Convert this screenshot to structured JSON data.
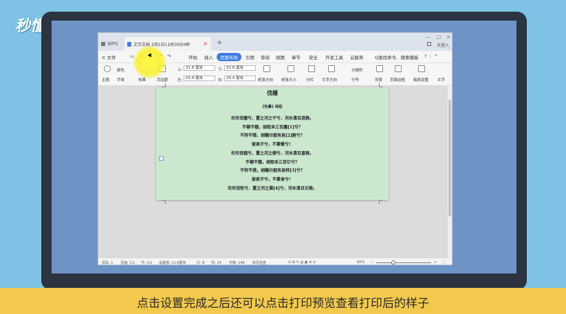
{
  "watermark": {
    "logo_text": "秒懂视频"
  },
  "caption": "点击设置完成之后还可以点击打印预览查看打印后的样子",
  "titlebar": {
    "wps_label": "WPS",
    "doc_tab_label": "文字文档 3月1日11时30分4秒",
    "close_glyph": "×",
    "new_tab_glyph": "+",
    "user_label": "未登入",
    "window_controls": [
      "—",
      "□",
      "×"
    ]
  },
  "menubar": {
    "file_label": "≡ 文件",
    "items": [
      "开始",
      "插入",
      "页面布局",
      "引用",
      "审阅",
      "视图",
      "章节",
      "安全",
      "开发工具",
      "云服务"
    ],
    "active_item": "页面布局",
    "search_label": "Q查找命令、搜索模板",
    "help_glyphs": "?  ⋮  ^"
  },
  "ribbon": {
    "theme_label": "主题",
    "color_label": "颜色",
    "font_label": "字体",
    "effect_label": "效果",
    "margin_label": "页边距",
    "top_label": "上:",
    "top_value": "31.8 毫米",
    "bottom_label": "下:",
    "bottom_value": "31.8 毫米",
    "left_label": "左:",
    "left_value": "25.4 毫米",
    "right_label": "右:",
    "right_value": "25.4 毫米",
    "orientation_label": "纸张方向",
    "size_label": "纸张大小",
    "columns_label": "分栏",
    "text_dir_label": "文字方向",
    "line_no_label": "行号",
    "breaks_label": "分隔符",
    "background_label": "背景",
    "border_label": "页面边框",
    "draft_label": "稿纸设置",
    "wrap_label": "文字"
  },
  "document": {
    "title": "伐檀",
    "subtitle": "[先秦] 诗经",
    "lines": [
      "坎坎伐檀兮，置之河之干兮，河水清且涟猗。",
      "不稼不穑，胡取禾三百廛[1]兮？",
      "不狩不猎，胡瞻尔庭有县[2]貆兮？",
      "彼君子兮，不素餐兮！",
      "坎坎伐辐兮，置之河之侧兮，河水清且直猗。",
      "不稼不穑，胡取禾三百亿兮？",
      "不狩不猎，胡瞻尔庭有县特[3]兮？",
      "彼君子兮，不素食兮！",
      "坎坎伐轮兮，置之河之漘[4]兮，河水清且沦猗。"
    ]
  },
  "statusbar": {
    "page": "页码: 1",
    "pages": "页面: 1/1",
    "section": "节: 1/1",
    "setting": "设置值: 11.9厘米",
    "row": "行: 8",
    "col": "列: 14",
    "words": "字数: 146",
    "spell": "拼写检查",
    "zoom": "60%",
    "zoom_minus": "−",
    "zoom_plus": "+"
  }
}
